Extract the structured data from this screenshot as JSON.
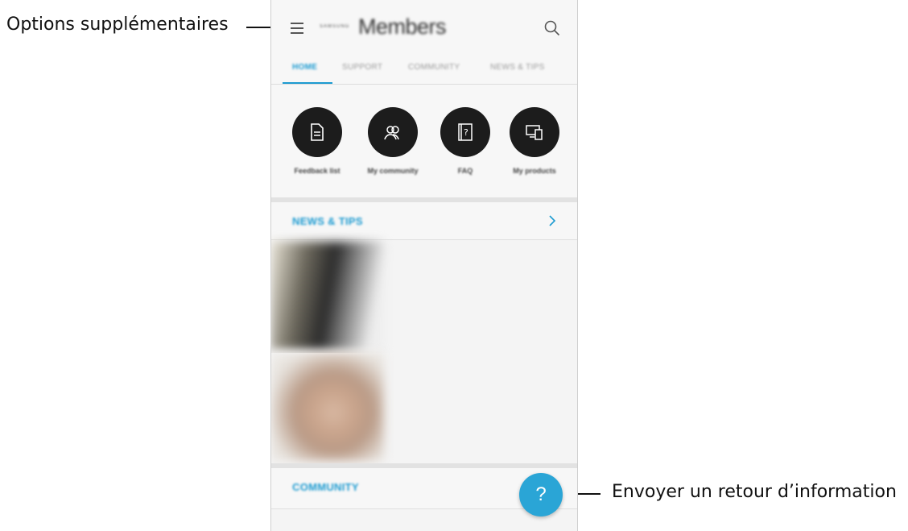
{
  "callouts": {
    "options": "Options supplémentaires",
    "feedback": "Envoyer un retour d’information"
  },
  "appbar": {
    "brand_prefix": "SAMSUNG",
    "brand_title": "Members",
    "icons": [
      "menu-icon",
      "search-icon"
    ]
  },
  "tabs": [
    {
      "label": "HOME",
      "active": true
    },
    {
      "label": "SUPPORT",
      "active": false
    },
    {
      "label": "COMMUNITY",
      "active": false
    },
    {
      "label": "NEWS & TIPS",
      "active": false
    }
  ],
  "shortcuts": [
    {
      "label": "Feedback list",
      "icon": "document-icon"
    },
    {
      "label": "My community",
      "icon": "people-icon"
    },
    {
      "label": "FAQ",
      "icon": "question-book-icon"
    },
    {
      "label": "My products",
      "icon": "devices-icon"
    }
  ],
  "news_section": {
    "title": "NEWS & TIPS",
    "icon": "chevron-right-icon"
  },
  "community_section": {
    "title": "COMMUNITY"
  },
  "fab": {
    "symbol": "?",
    "icon": "question-icon"
  },
  "colors": {
    "accent": "#1d9bd1",
    "fab": "#2aa5d6",
    "shortcut_bg": "#1c1c1c"
  }
}
